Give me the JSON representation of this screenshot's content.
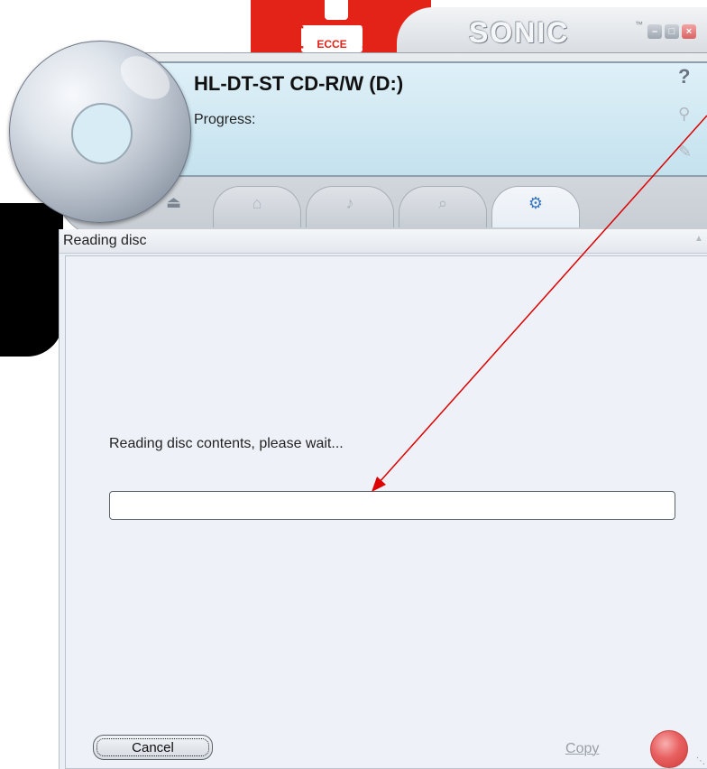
{
  "banner": {
    "brand_badge": "ECCE"
  },
  "window": {
    "brand": "SONIC",
    "trademark": "™",
    "buttons": {
      "minimize": "–",
      "maximize": "□",
      "close": "×"
    }
  },
  "header": {
    "drive_name": "HL-DT-ST CD-R/W (D:)",
    "progress_label": "Progress:",
    "side_icons": {
      "help": "?",
      "zoom": "⚲",
      "edit": "✎"
    }
  },
  "tabs": [
    {
      "icon": "house-icon",
      "glyph": "⌂",
      "active": false
    },
    {
      "icon": "music-icon",
      "glyph": "♪",
      "active": false
    },
    {
      "icon": "speech-icon",
      "glyph": "⌕",
      "active": false
    },
    {
      "icon": "copy-disc-icon",
      "glyph": "⚙",
      "active": true
    }
  ],
  "eject_glyph": "⏏",
  "dialog": {
    "title": "Reading disc",
    "message": "Reading disc contents, please wait...",
    "progress": 0,
    "cancel_label": "Cancel",
    "copy_label_underlined": "C",
    "copy_label_rest": "opy"
  },
  "colors": {
    "banner_red": "#e32218",
    "panel_bg": "#eaeff6",
    "annotation_arrow": "#dd0000",
    "record_button": "#e86060"
  }
}
